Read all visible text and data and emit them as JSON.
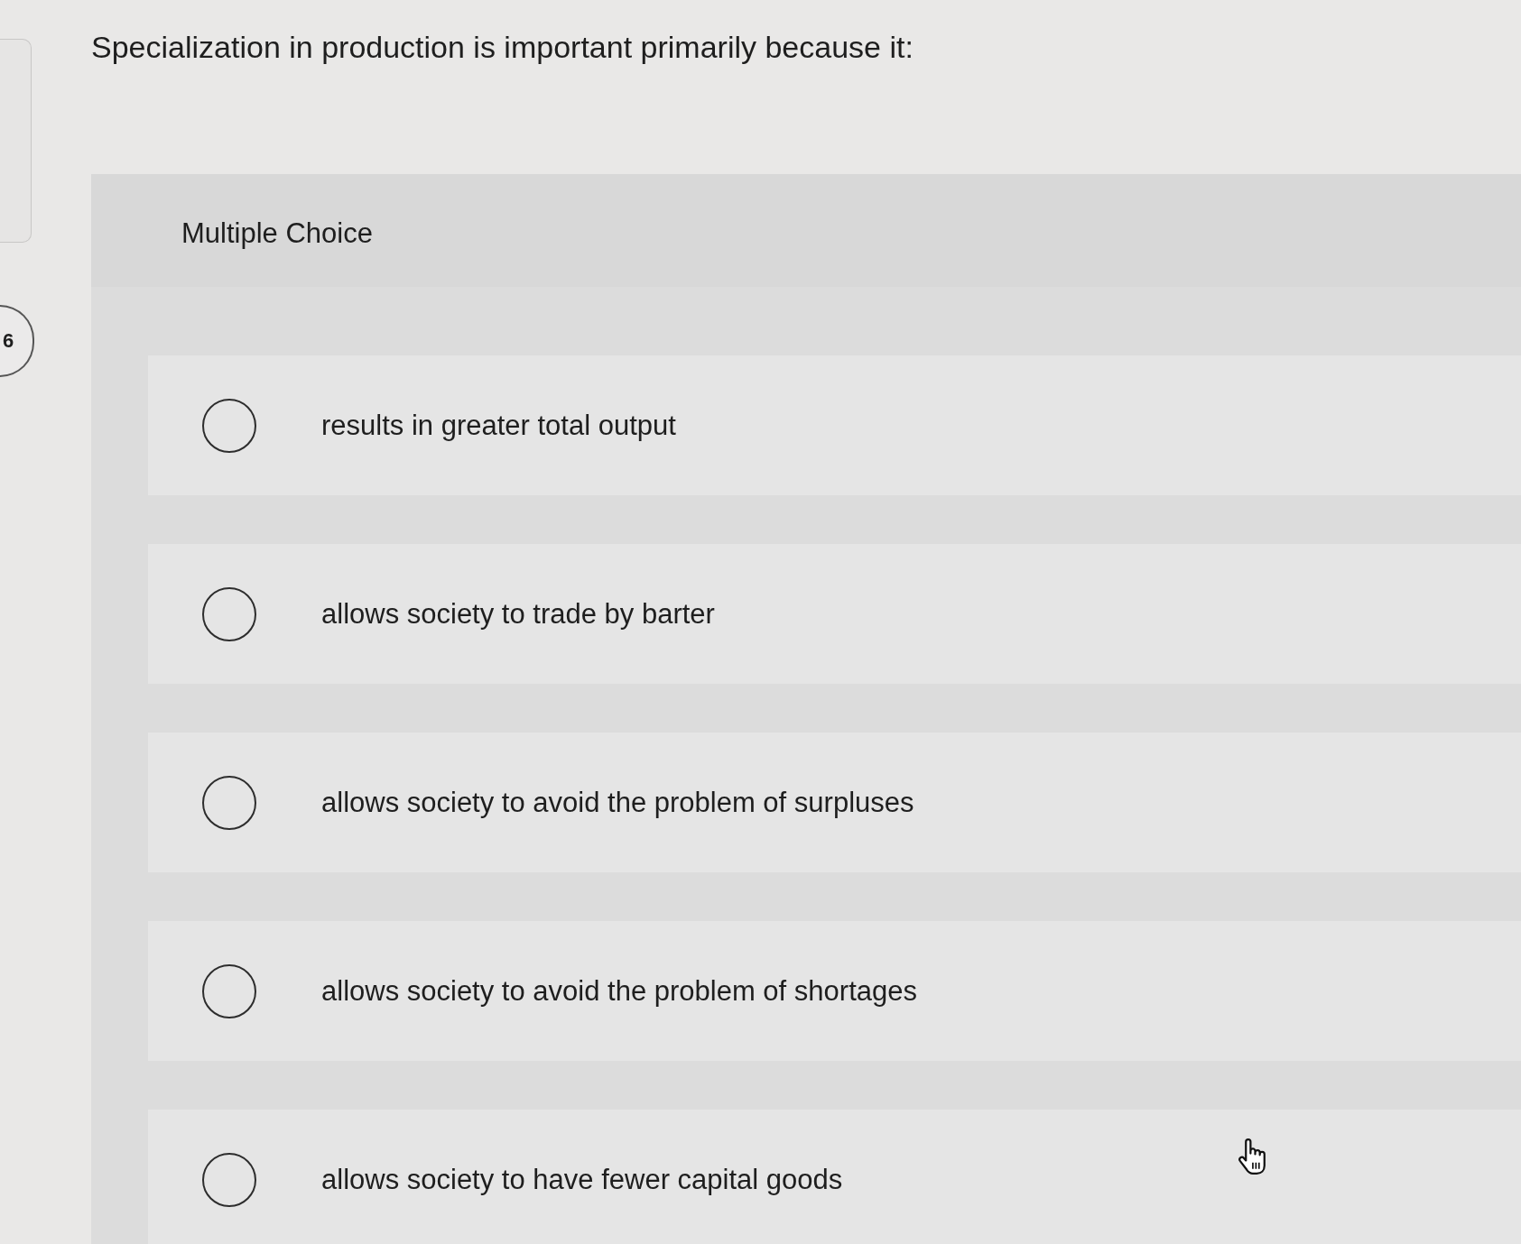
{
  "question_badge": "6",
  "question": "Specialization in production is important primarily because it:",
  "answer_panel": {
    "heading": "Multiple Choice",
    "choices": [
      {
        "label": "results in greater total output",
        "selected": false
      },
      {
        "label": "allows society to trade by barter",
        "selected": false
      },
      {
        "label": "allows society to avoid the problem of surpluses",
        "selected": false
      },
      {
        "label": "allows society to avoid the problem of shortages",
        "selected": false
      },
      {
        "label": "allows society to have fewer capital goods",
        "selected": false
      }
    ]
  }
}
